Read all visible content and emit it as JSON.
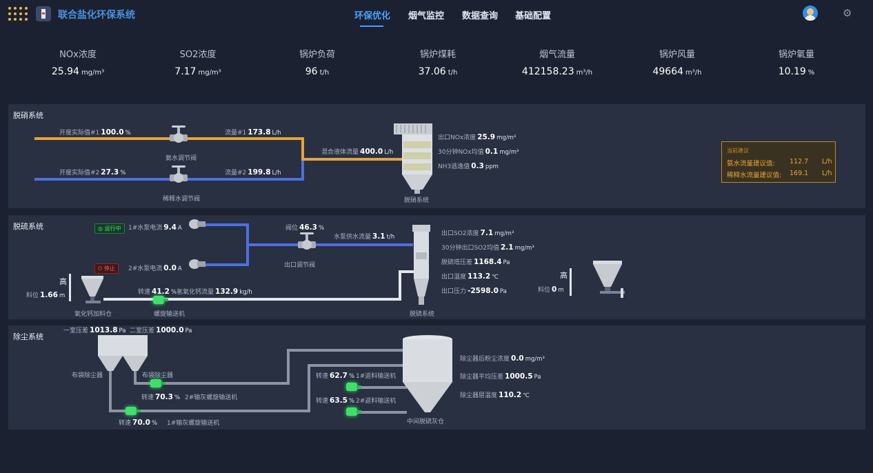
{
  "app": {
    "title": "联合盐化环保系统"
  },
  "nav": [
    "环保优化",
    "烟气监控",
    "数据查询",
    "基础配置"
  ],
  "kpis": [
    {
      "label": "NOx浓度",
      "value": "25.94",
      "unit": "mg/m³"
    },
    {
      "label": "SO2浓度",
      "value": "7.17",
      "unit": "mg/m³"
    },
    {
      "label": "锅炉负荷",
      "value": "96",
      "unit": "t/h"
    },
    {
      "label": "锅炉煤耗",
      "value": "37.06",
      "unit": "t/h"
    },
    {
      "label": "烟气流量",
      "value": "412158.23",
      "unit": "m³/h"
    },
    {
      "label": "锅炉风量",
      "value": "49664",
      "unit": "m³/h"
    },
    {
      "label": "锅炉氧量",
      "value": "10.19",
      "unit": "%"
    }
  ],
  "denitration": {
    "title": "脱硝系统",
    "opening1_label": "开度实际值#1",
    "opening1_value": "100.0",
    "opening1_unit": "%",
    "flow1_label": "流量#1",
    "flow1_value": "173.8",
    "flow1_unit": "L/h",
    "valve1_label": "氨水调节阀",
    "opening2_label": "开度实际值#2",
    "opening2_value": "27.3",
    "opening2_unit": "%",
    "flow2_label": "流量#2",
    "flow2_value": "199.8",
    "flow2_unit": "L/h",
    "valve2_label": "稀释水调节阀",
    "mix_label": "混合液体流量",
    "mix_value": "400.0",
    "mix_unit": "L/h",
    "tower_label": "脱硝系统",
    "out_nox_label": "出口NOx浓度",
    "out_nox_value": "25.9",
    "out_nox_unit": "mg/m³",
    "avg_nox_label": "30分钟NOx均值",
    "avg_nox_value": "0.1",
    "avg_nox_unit": "mg/m³",
    "nh3_label": "NH3逃逸值",
    "nh3_value": "0.3",
    "nh3_unit": "ppm",
    "suggest": {
      "header": "当前建议",
      "ammonia_label": "氨水流量建议值:",
      "ammonia_value": "112.7",
      "ammonia_unit": "L/h",
      "water_label": "稀释水流量建议值:",
      "water_value": "169.1",
      "water_unit": "L/h"
    }
  },
  "desulfurization": {
    "title": "脱硫系统",
    "pump1_status": "运行中",
    "pump1_label": "1#水泵电流",
    "pump1_value": "9.4",
    "pump1_unit": "A",
    "pump2_status": "停止",
    "pump2_label": "2#水泵电流",
    "pump2_value": "0.0",
    "pump2_unit": "A",
    "valve_pos_label": "阀位",
    "valve_pos_value": "46.3",
    "valve_pos_unit": "%",
    "valve_label": "出口调节阀",
    "supply_label": "水泵供水流量",
    "supply_value": "3.1",
    "supply_unit": "t/h",
    "hopper_level_high": "高",
    "hopper_level_label": "料位",
    "hopper_level_value": "1.66",
    "hopper_level_unit": "m",
    "hopper_label": "氧化钙加料仓",
    "speed_label": "转速",
    "speed_value": "41.2",
    "speed_unit": "%",
    "caoh_label": "氢氧化钙流量",
    "caoh_value": "132.9",
    "caoh_unit": "kg/h",
    "screw_label": "螺旋输送机",
    "tower_label": "脱硫系统",
    "out_so2_label": "出口SO2浓度",
    "out_so2_value": "7.1",
    "out_so2_unit": "mg/m³",
    "avg_so2_label": "30分钟出口SO2均值",
    "avg_so2_value": "2.1",
    "avg_so2_unit": "mg/m³",
    "dp_label": "脱硫塔压差",
    "dp_value": "1168.4",
    "dp_unit": "Pa",
    "temp_label": "出口温度",
    "temp_value": "113.2",
    "temp_unit": "℃",
    "press_label": "出口压力",
    "press_value": "-2598.0",
    "press_unit": "Pa",
    "hopper2_level_high": "高",
    "hopper2_level_label": "料位",
    "hopper2_level_value": "0",
    "hopper2_level_unit": "m"
  },
  "dust": {
    "title": "除尘系统",
    "room1_label": "一室压差",
    "room1_value": "1013.8",
    "room1_unit": "Pa",
    "room2_label": "二室压差",
    "room2_value": "1000.0",
    "room2_unit": "Pa",
    "bag1_label": "布袋除尘器",
    "bag2_label": "布袋除尘器",
    "speed2_label": "转速",
    "speed2_value": "70.3",
    "speed2_unit": "%",
    "screw2_label": "2#输灰螺旋输送机",
    "speed1_label": "转速",
    "speed1_value": "70.0",
    "speed1_unit": "%",
    "screw1_label": "1#输灰螺旋输送机",
    "conv1_speed_label": "转速",
    "conv1_speed_value": "62.7",
    "conv1_speed_unit": "%",
    "conv1_label": "1#返料输送机",
    "conv2_speed_label": "转速",
    "conv2_speed_value": "63.5",
    "conv2_speed_unit": "%",
    "conv2_label": "2#返料输送机",
    "silo_label": "中间脱硫灰仓",
    "dust_label": "除尘器后粉尘浓度",
    "dust_value": "0.0",
    "dust_unit": "mg/m³",
    "avgdp_label": "除尘器平均压差",
    "avgdp_value": "1000.5",
    "avgdp_unit": "Pa",
    "bagtemp_label": "除尘器层温度",
    "bagtemp_value": "110.2",
    "bagtemp_unit": "℃"
  }
}
